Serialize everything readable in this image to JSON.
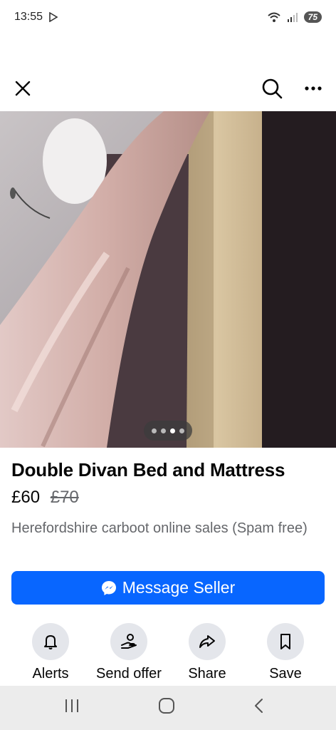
{
  "status_bar": {
    "time": "13:55",
    "battery": "75"
  },
  "listing": {
    "title": "Double Divan Bed and Mattress",
    "price": "£60",
    "original_price": "£70",
    "group": "Herefordshire carboot online sales (Spam free)",
    "photo_count": 4,
    "active_photo": 3
  },
  "buttons": {
    "message_seller": "Message Seller"
  },
  "actions": [
    {
      "label": "Alerts",
      "icon": "bell-icon"
    },
    {
      "label": "Send offer",
      "icon": "send-offer-icon"
    },
    {
      "label": "Share",
      "icon": "share-icon"
    },
    {
      "label": "Save",
      "icon": "bookmark-icon"
    }
  ],
  "colors": {
    "accent": "#0866ff",
    "secondary_text": "#65676b",
    "icon_bg": "#e4e6eb"
  }
}
